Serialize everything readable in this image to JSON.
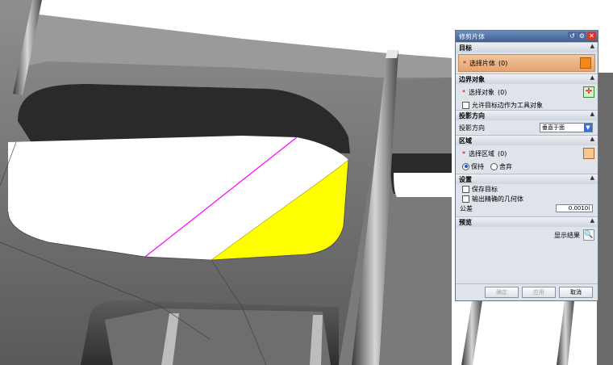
{
  "dialog": {
    "title": "修剪片体",
    "sections": {
      "target": {
        "header": "目标",
        "select_label": "选择片体",
        "select_count": "(0)"
      },
      "boundary": {
        "header": "边界对象",
        "select_label": "选择对象",
        "select_count": "(0)",
        "checkbox_label": "允许目标边作为工具对象"
      },
      "projection": {
        "header": "投影方向",
        "label": "投影方向",
        "value": "垂直于面"
      },
      "region": {
        "header": "区域",
        "select_label": "选择区域",
        "select_count": "(0)",
        "option_keep": "保持",
        "option_discard": "舍弃"
      },
      "settings": {
        "header": "设置",
        "keep_target": "保存目标",
        "output_exact": "输出精确的几何体",
        "tolerance_label": "公差",
        "tolerance_value": "0.0010("
      },
      "preview": {
        "header": "预览",
        "show_result": "显示结果"
      }
    },
    "buttons": {
      "ok": "确定",
      "apply": "应用",
      "cancel": "取消"
    }
  },
  "colors": {
    "trim_region": "#ffff00",
    "boundary_line": "#ff00ff",
    "title_bar": "#4a6a9c"
  }
}
